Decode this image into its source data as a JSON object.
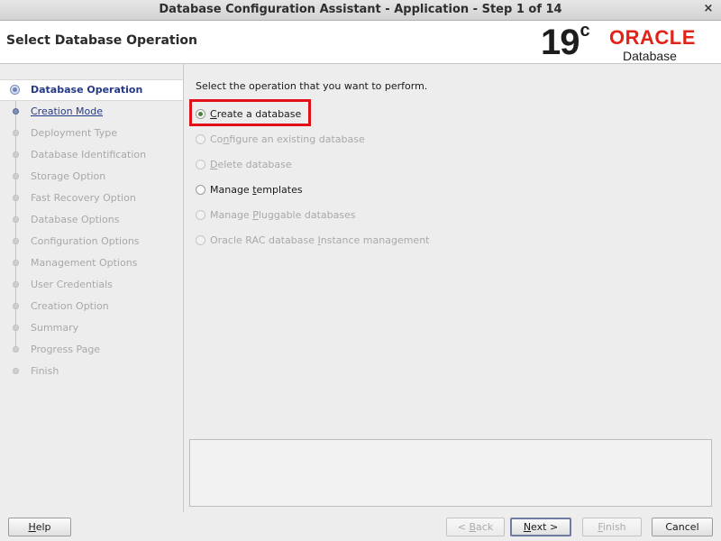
{
  "window": {
    "title": "Database Configuration Assistant - Application - Step 1 of 14",
    "close_glyph": "×"
  },
  "header": {
    "page_title": "Select Database Operation",
    "logo": {
      "version_number": "19",
      "version_suffix": "c",
      "brand": "ORACLE",
      "product": "Database",
      "brand_color": "#e2231a"
    }
  },
  "sidebar": {
    "steps": [
      {
        "label": "Database Operation",
        "state": "active"
      },
      {
        "label": "Creation Mode",
        "state": "link"
      },
      {
        "label": "Deployment Type",
        "state": "disabled"
      },
      {
        "label": "Database Identification",
        "state": "disabled"
      },
      {
        "label": "Storage Option",
        "state": "disabled"
      },
      {
        "label": "Fast Recovery Option",
        "state": "disabled"
      },
      {
        "label": "Database Options",
        "state": "disabled"
      },
      {
        "label": "Configuration Options",
        "state": "disabled"
      },
      {
        "label": "Management Options",
        "state": "disabled"
      },
      {
        "label": "User Credentials",
        "state": "disabled"
      },
      {
        "label": "Creation Option",
        "state": "disabled"
      },
      {
        "label": "Summary",
        "state": "disabled"
      },
      {
        "label": "Progress Page",
        "state": "disabled"
      },
      {
        "label": "Finish",
        "state": "disabled"
      }
    ]
  },
  "main": {
    "instruction": "Select the operation that you want to perform.",
    "options": [
      {
        "pre": "",
        "mnemonic": "C",
        "post": "reate a database",
        "selected": true,
        "enabled": true
      },
      {
        "pre": "Co",
        "mnemonic": "n",
        "post": "figure an existing database",
        "selected": false,
        "enabled": false
      },
      {
        "pre": "",
        "mnemonic": "D",
        "post": "elete database",
        "selected": false,
        "enabled": false
      },
      {
        "pre": "Manage ",
        "mnemonic": "t",
        "post": "emplates",
        "selected": false,
        "enabled": true
      },
      {
        "pre": "Manage ",
        "mnemonic": "P",
        "post": "luggable databases",
        "selected": false,
        "enabled": false
      },
      {
        "pre": "Oracle RAC database ",
        "mnemonic": "I",
        "post": "nstance management",
        "selected": false,
        "enabled": false
      }
    ],
    "highlight_color": "#e01018",
    "selected_radio_color": "#4c7f3b"
  },
  "footer": {
    "help": {
      "mnemonic": "H",
      "post": "elp"
    },
    "back": {
      "pre": "< ",
      "mnemonic": "B",
      "post": "ack"
    },
    "next": {
      "pre": "",
      "mnemonic": "N",
      "post": "ext >"
    },
    "finish": {
      "pre": "",
      "mnemonic": "F",
      "post": "inish"
    },
    "cancel": {
      "label": "Cancel"
    }
  }
}
